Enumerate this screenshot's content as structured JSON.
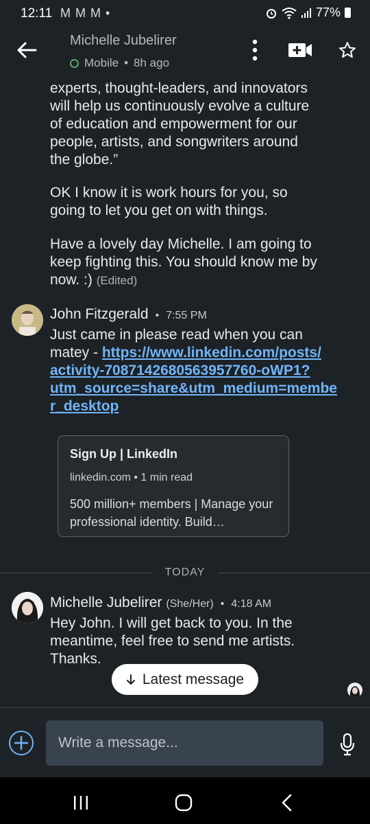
{
  "status_bar": {
    "time": "12:11",
    "notif_icons": "M M M •",
    "battery": "77%"
  },
  "header": {
    "name": "Michelle Jubelirer",
    "presence": "Mobile",
    "last_seen": "8h ago"
  },
  "messages": {
    "m1_para1": [
      "experts, thought-leaders, and innovators",
      "will help us continuously evolve a culture",
      "of education and empowerment for our",
      "people, artists, and songwriters around",
      "the globe.”"
    ],
    "m1_para2": [
      "OK I know it is work hours for you, so",
      "going to let you get on with things."
    ],
    "m1_para3": [
      "Have a lovely day Michelle. I am going to",
      "keep fighting this. You should know me by",
      "now. :)"
    ],
    "m1_edited": "(Edited)",
    "m2_sender": "John Fitzgerald",
    "m2_time": "7:55 PM",
    "m2_text_line1": "Just came in please read when you can",
    "m2_text_prefix": "matey - ",
    "m2_link": [
      "https://www.linkedin.com/posts/",
      "activity-7087142680563957760-oWP1?",
      "utm_source=share&utm_medium=membe",
      "r_desktop"
    ],
    "card_title": "Sign Up | LinkedIn",
    "card_meta": "linkedin.com • 1 min read",
    "card_desc": "500 million+ members | Manage your professional identity. Build…",
    "date_divider": "TODAY",
    "m3_sender": "Michelle Jubelirer",
    "m3_pronouns": "(She/Her)",
    "m3_time": "4:18 AM",
    "m3_text": [
      "Hey John. I will get back to you. In the",
      "meantime, feel free to send me artists.",
      "Thanks."
    ]
  },
  "latest_button": "Latest message",
  "composer": {
    "placeholder": "Write a message..."
  },
  "colors": {
    "background": "#1d2226",
    "link": "#70b5f9",
    "online_ring": "#55a670",
    "input_bg": "#38434f"
  },
  "icons": [
    "back-arrow-icon",
    "more-vertical-icon",
    "video-call-icon",
    "star-icon",
    "plus-icon",
    "mic-icon",
    "nav-recents-icon",
    "nav-home-icon",
    "nav-back-icon"
  ]
}
